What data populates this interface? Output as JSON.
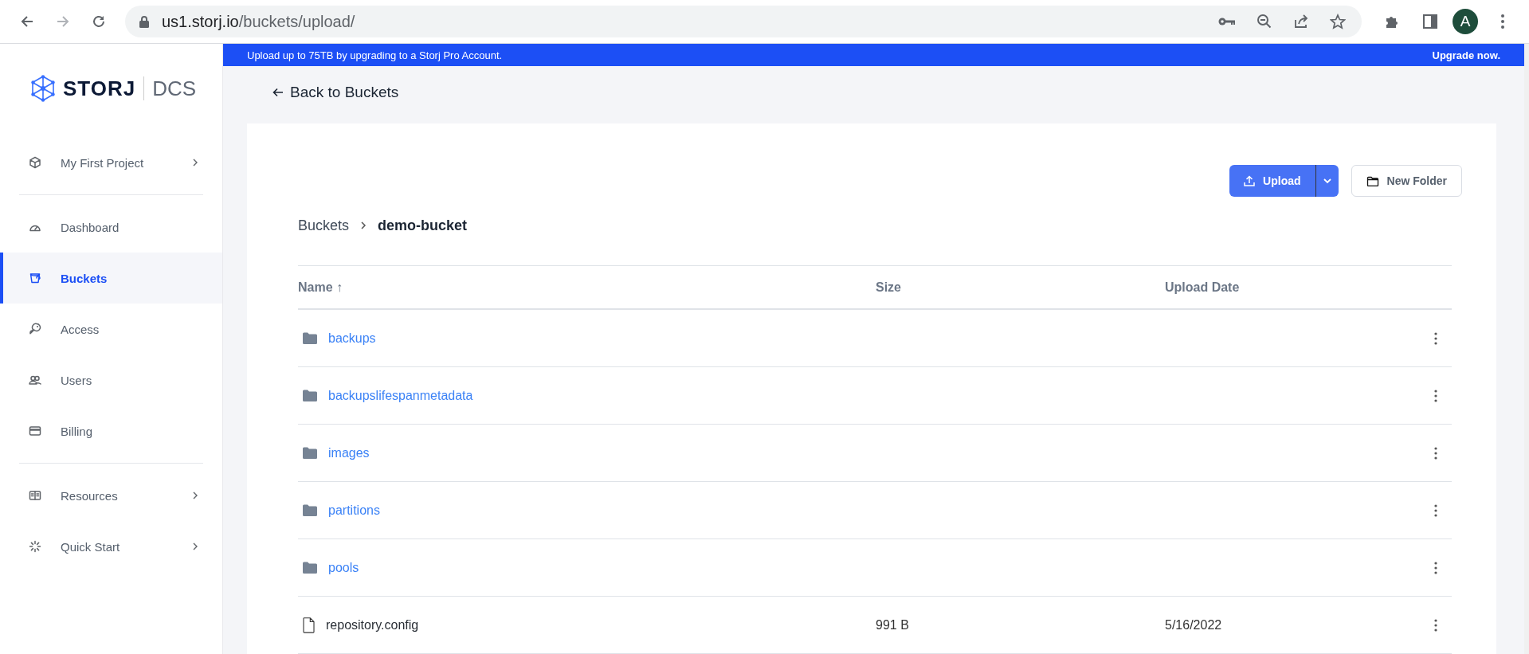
{
  "browser": {
    "url_host": "us1.storj.io",
    "url_path": "/buckets/upload/",
    "profile_initial": "A"
  },
  "banner": {
    "text": "Upload up to 75TB by upgrading to a Storj Pro Account.",
    "link": "Upgrade now."
  },
  "logo": {
    "brand": "STORJ",
    "product": "DCS"
  },
  "sidebar": {
    "groups": [
      {
        "items": [
          {
            "label": "My First Project",
            "chevron": true,
            "selected": false
          }
        ]
      },
      {
        "items": [
          {
            "label": "Dashboard",
            "chevron": false,
            "selected": false
          },
          {
            "label": "Buckets",
            "chevron": false,
            "selected": true
          },
          {
            "label": "Access",
            "chevron": false,
            "selected": false
          },
          {
            "label": "Users",
            "chevron": false,
            "selected": false
          },
          {
            "label": "Billing",
            "chevron": false,
            "selected": false
          }
        ]
      },
      {
        "items": [
          {
            "label": "Resources",
            "chevron": true,
            "selected": false
          },
          {
            "label": "Quick Start",
            "chevron": true,
            "selected": false
          }
        ]
      }
    ]
  },
  "back_link": "Back to Buckets",
  "toolbar": {
    "upload": "Upload",
    "new_folder": "New Folder"
  },
  "breadcrumb": [
    "Buckets",
    "demo-bucket"
  ],
  "table": {
    "columns": [
      "Name ↑",
      "Size",
      "Upload Date"
    ],
    "rows": [
      {
        "kind": "folder",
        "name": "backups"
      },
      {
        "kind": "folder",
        "name": "backupslifespanmetadata"
      },
      {
        "kind": "folder",
        "name": "images"
      },
      {
        "kind": "folder",
        "name": "partitions"
      },
      {
        "kind": "folder",
        "name": "pools"
      },
      {
        "kind": "file",
        "name": "repository.config",
        "size": "991 B",
        "date": "5/16/2022"
      }
    ]
  }
}
